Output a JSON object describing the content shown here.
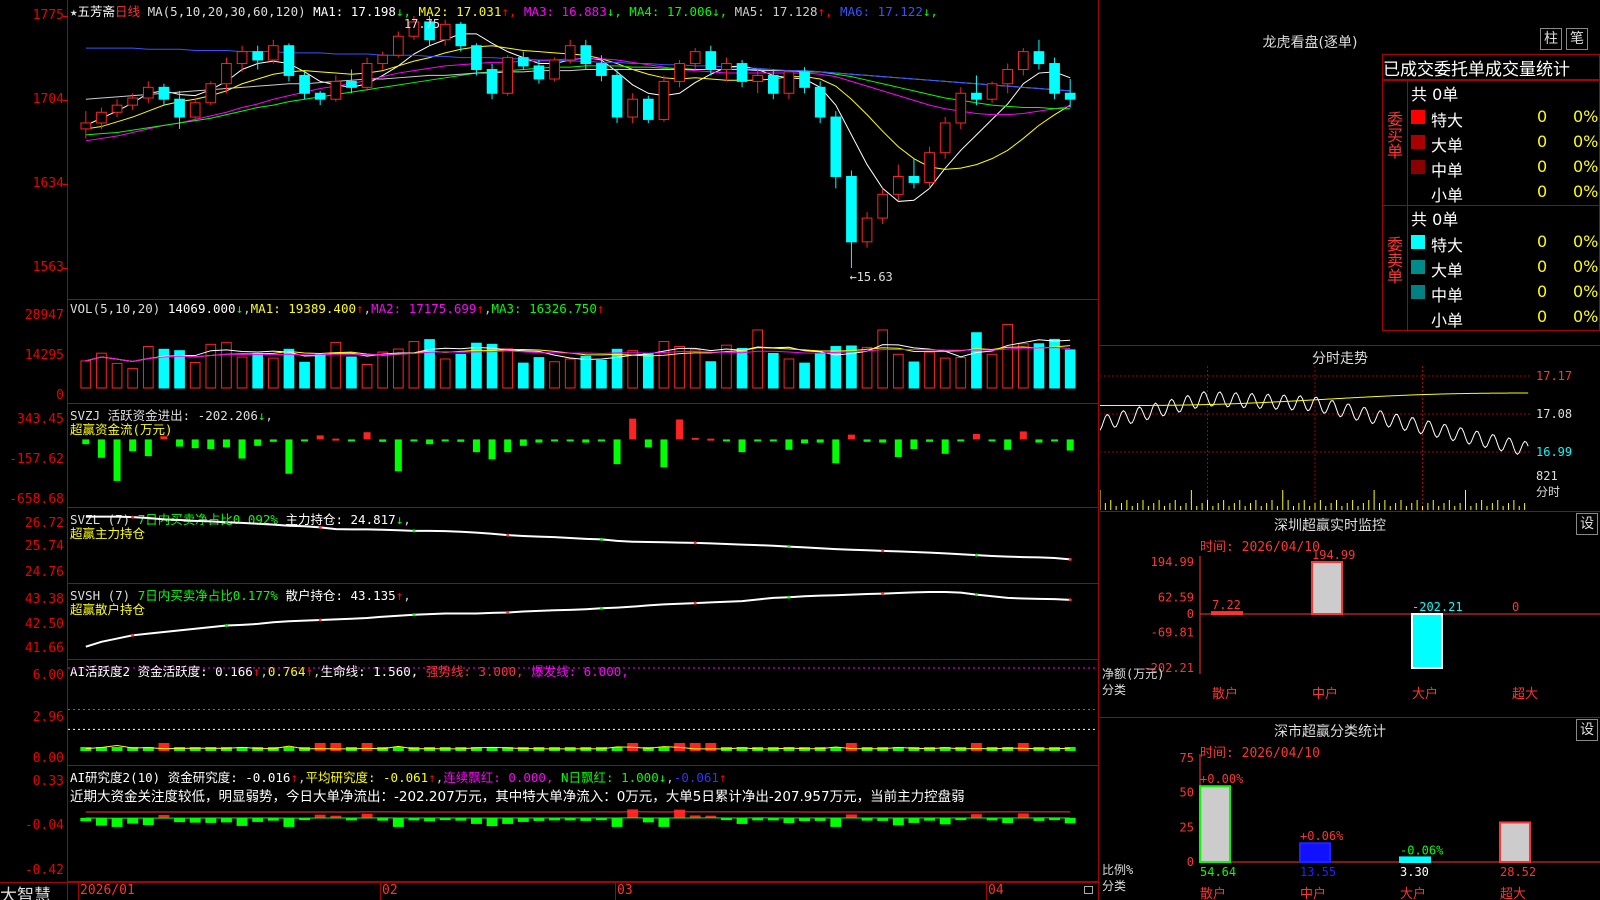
{
  "header": {
    "star": "★",
    "stock": "五芳斋",
    "period": "日线",
    "ma_params": "MA(5,10,20,30,60,120)",
    "ma": [
      {
        "l": "MA1:",
        "v": "17.198",
        "d": "↓",
        "c": "#ffffff"
      },
      {
        "l": "MA2:",
        "v": "17.031",
        "d": "↑",
        "c": "#ffff00"
      },
      {
        "l": "MA3:",
        "v": "16.883",
        "d": "↓",
        "c": "#ff00ff"
      },
      {
        "l": "MA4:",
        "v": "17.006",
        "d": "↓",
        "c": "#00ff00"
      },
      {
        "l": "MA5:",
        "v": "17.128",
        "d": "↑",
        "c": "#cccccc"
      },
      {
        "l": "MA6:",
        "v": "17.122",
        "d": "↓",
        "c": "#3355ff"
      }
    ]
  },
  "price_axis": [
    "1775",
    "1704",
    "1634",
    "1563"
  ],
  "annot_high": "17.75",
  "annot_low": "←15.63",
  "vol": {
    "title": "VOL(5,10,20)",
    "val": "14069.000",
    "arr": "↓",
    "ma1": "MA1: 19389.400",
    "ma2": "MA2: 17175.699",
    "ma3": "MA3: 16326.750",
    "axis": [
      "28947",
      "14295",
      "0"
    ]
  },
  "svzj": {
    "title": "SVZJ  活跃资金进出: -202.206",
    "sub": "超赢资金流(万元)",
    "axis": [
      "343.45",
      "-157.62",
      "-658.68"
    ]
  },
  "svzl": {
    "title": "SVZL (7)",
    "g": "7日内买卖净占比0.092%",
    "w": "主力持仓: 24.817",
    "sub": "超赢主力持仓",
    "axis": [
      "26.72",
      "25.74",
      "24.76"
    ]
  },
  "svsh": {
    "title": "SVSH (7)",
    "g": "7日内买卖净占比0.177%",
    "w": "散户持仓: 43.135",
    "sub": "超赢散户持仓",
    "axis": [
      "43.38",
      "42.50",
      "41.66"
    ]
  },
  "ai2": {
    "a": "AI活跃度2 资金活跃度: 0.166",
    "b": "0.764",
    "c": "生命线: 1.560,",
    "d": "强势线: 3.000,",
    "e": "爆发线: 6.000,",
    "axis": [
      "6.00",
      "2.96",
      "0.00"
    ]
  },
  "ai3": {
    "a": "AI研究度2(10) 资金研究度: -0.016",
    "b": "平均研究度: -0.061",
    "c": "连续飘红: 0.000,",
    "d": "N日飘红: 1.000",
    "e": "-0.061",
    "axis": [
      "0.33",
      "-0.04",
      "-0.42"
    ],
    "text": "近期大资金关注度较低，明显弱势，今日大单净流出：-202.207万元，其中特大单净流入：0万元，大单5日累计净出-207.957万元，当前主力控盘弱"
  },
  "dates": [
    "2026/01",
    "02",
    "03",
    "04"
  ],
  "logo": "大智慧",
  "right": {
    "lhb_title": "龙虎看盘(逐单)",
    "tab_zhu": "柱",
    "tab_bi": "笔",
    "tabs": [
      "已成交",
      "委托单",
      "成交量统计"
    ],
    "buy": {
      "side": "委买单",
      "total": "共 0单",
      "rows": [
        {
          "n": "特大",
          "v": "0",
          "p": "0%",
          "c": "#ff0000"
        },
        {
          "n": "大单",
          "v": "0",
          "p": "0%",
          "c": "#aa0000"
        },
        {
          "n": "中单",
          "v": "0",
          "p": "0%",
          "c": "#880000"
        },
        {
          "n": "小单",
          "v": "0",
          "p": "0%",
          "c": "#000000"
        }
      ]
    },
    "sell": {
      "side": "委卖单",
      "total": "共 0单",
      "rows": [
        {
          "n": "特大",
          "v": "0",
          "p": "0%",
          "c": "#00ffff"
        },
        {
          "n": "大单",
          "v": "0",
          "p": "0%",
          "c": "#008b8b"
        },
        {
          "n": "中单",
          "v": "0",
          "p": "0%",
          "c": "#008080"
        },
        {
          "n": "小单",
          "v": "0",
          "p": "0%",
          "c": "#000000"
        }
      ]
    },
    "fs_title": "分时走势",
    "fs_axis": [
      "17.17",
      "17.08",
      "16.99"
    ],
    "fs_vol": "821",
    "fs_unit": "分时",
    "sz_title": "深圳超赢实时监控",
    "sz_set": "设",
    "sz_time": "时间: 2026/04/10",
    "sz_axis": [
      "194.99",
      "62.59",
      "0",
      "-69.81",
      "-202.21"
    ],
    "sz_ylabel": "净额(万元)",
    "sz_xlabel": "分类",
    "sz_vals": [
      {
        "cat": "散户",
        "v": "7.22"
      },
      {
        "cat": "中户",
        "v": "194.99"
      },
      {
        "cat": "大户",
        "v": "-202.21"
      },
      {
        "cat": "超大",
        "v": "0"
      }
    ],
    "cls_title": "深市超赢分类统计",
    "cls_set": "设",
    "cls_time": "时间: 2026/04/10",
    "cls_axis": [
      "75",
      "50",
      "25",
      "0"
    ],
    "cls_ylabel": "比例%",
    "cls_xlabel": "分类",
    "cls_vals": [
      {
        "cat": "散户",
        "v": "54.64",
        "chg": "+0.00%"
      },
      {
        "cat": "中户",
        "v": "13.55",
        "chg": "+0.06%"
      },
      {
        "cat": "大户",
        "v": "3.30",
        "chg": "-0.06%"
      },
      {
        "cat": "超大",
        "v": "28.52",
        "chg": ""
      }
    ]
  },
  "chart_data": {
    "type": "candlestick",
    "title": "五芳斋 日线",
    "ohlc": [
      [
        16.8,
        16.95,
        16.72,
        16.85
      ],
      [
        16.85,
        16.98,
        16.8,
        16.94
      ],
      [
        16.94,
        17.05,
        16.9,
        17.0
      ],
      [
        17.0,
        17.1,
        16.96,
        17.06
      ],
      [
        17.06,
        17.2,
        17.02,
        17.15
      ],
      [
        17.15,
        17.18,
        17.0,
        17.05
      ],
      [
        17.05,
        17.12,
        16.8,
        16.9
      ],
      [
        16.9,
        17.06,
        16.88,
        17.02
      ],
      [
        17.02,
        17.2,
        17.0,
        17.18
      ],
      [
        17.18,
        17.4,
        17.1,
        17.35
      ],
      [
        17.35,
        17.5,
        17.28,
        17.45
      ],
      [
        17.45,
        17.5,
        17.3,
        17.38
      ],
      [
        17.38,
        17.55,
        17.35,
        17.5
      ],
      [
        17.5,
        17.52,
        17.2,
        17.25
      ],
      [
        17.25,
        17.28,
        17.05,
        17.1
      ],
      [
        17.1,
        17.12,
        17.0,
        17.05
      ],
      [
        17.05,
        17.25,
        17.03,
        17.2
      ],
      [
        17.2,
        17.3,
        17.1,
        17.15
      ],
      [
        17.15,
        17.4,
        17.12,
        17.35
      ],
      [
        17.35,
        17.45,
        17.3,
        17.42
      ],
      [
        17.42,
        17.62,
        17.4,
        17.58
      ],
      [
        17.58,
        17.75,
        17.55,
        17.7
      ],
      [
        17.7,
        17.75,
        17.5,
        17.55
      ],
      [
        17.55,
        17.72,
        17.5,
        17.68
      ],
      [
        17.68,
        17.7,
        17.45,
        17.5
      ],
      [
        17.5,
        17.52,
        17.25,
        17.3
      ],
      [
        17.3,
        17.35,
        17.05,
        17.1
      ],
      [
        17.1,
        17.42,
        17.08,
        17.4
      ],
      [
        17.4,
        17.45,
        17.3,
        17.33
      ],
      [
        17.33,
        17.38,
        17.18,
        17.22
      ],
      [
        17.22,
        17.4,
        17.2,
        17.38
      ],
      [
        17.38,
        17.55,
        17.35,
        17.5
      ],
      [
        17.5,
        17.55,
        17.3,
        17.35
      ],
      [
        17.35,
        17.42,
        17.2,
        17.25
      ],
      [
        17.25,
        17.3,
        16.85,
        16.9
      ],
      [
        16.9,
        17.1,
        16.85,
        17.05
      ],
      [
        17.05,
        17.08,
        16.85,
        16.88
      ],
      [
        16.88,
        17.25,
        16.86,
        17.2
      ],
      [
        17.2,
        17.38,
        17.15,
        17.35
      ],
      [
        17.35,
        17.48,
        17.3,
        17.45
      ],
      [
        17.45,
        17.5,
        17.25,
        17.3
      ],
      [
        17.3,
        17.4,
        17.2,
        17.35
      ],
      [
        17.35,
        17.38,
        17.15,
        17.2
      ],
      [
        17.2,
        17.3,
        17.1,
        17.25
      ],
      [
        17.25,
        17.3,
        17.05,
        17.1
      ],
      [
        17.1,
        17.3,
        17.05,
        17.28
      ],
      [
        17.28,
        17.32,
        17.1,
        17.15
      ],
      [
        17.15,
        17.2,
        16.85,
        16.9
      ],
      [
        16.9,
        16.95,
        16.3,
        16.4
      ],
      [
        16.4,
        16.45,
        15.63,
        15.85
      ],
      [
        15.85,
        16.1,
        15.8,
        16.05
      ],
      [
        16.05,
        16.3,
        16.0,
        16.25
      ],
      [
        16.25,
        16.5,
        16.2,
        16.4
      ],
      [
        16.4,
        16.55,
        16.3,
        16.35
      ],
      [
        16.35,
        16.65,
        16.3,
        16.6
      ],
      [
        16.6,
        16.9,
        16.55,
        16.85
      ],
      [
        16.85,
        17.15,
        16.8,
        17.1
      ],
      [
        17.1,
        17.25,
        17.0,
        17.05
      ],
      [
        17.05,
        17.2,
        17.02,
        17.18
      ],
      [
        17.18,
        17.35,
        17.1,
        17.3
      ],
      [
        17.3,
        17.48,
        17.25,
        17.45
      ],
      [
        17.45,
        17.55,
        17.3,
        17.35
      ],
      [
        17.35,
        17.4,
        17.05,
        17.1
      ],
      [
        17.1,
        17.22,
        16.98,
        17.05
      ]
    ],
    "volume": [
      9800,
      12600,
      8900,
      7000,
      15000,
      14000,
      13500,
      9200,
      15800,
      16400,
      11200,
      12500,
      10800,
      14000,
      9300,
      12100,
      16500,
      11200,
      8500,
      13000,
      14100,
      16800,
      17500,
      10500,
      12200,
      16200,
      15800,
      14200,
      9000,
      11000,
      9500,
      10500,
      11500,
      10000,
      14000,
      13500,
      12500,
      16800,
      15000,
      13800,
      9500,
      15500,
      14300,
      21000,
      12500,
      10500,
      9000,
      12600,
      15000,
      15200,
      14700,
      21000,
      12200,
      9400,
      13000,
      10800,
      11000,
      20000,
      12200,
      23000,
      16000,
      16000,
      17600,
      13800
    ],
    "ma5": [
      16.83,
      16.89,
      16.95,
      17.02,
      17.1,
      17.12,
      17.09,
      17.08,
      17.13,
      17.2,
      17.3,
      17.35,
      17.37,
      17.35,
      17.28,
      17.2,
      17.17,
      17.15,
      17.18,
      17.25,
      17.33,
      17.43,
      17.5,
      17.55,
      17.6,
      17.6,
      17.52,
      17.45,
      17.4,
      17.35,
      17.35,
      17.38,
      17.4,
      17.38,
      17.28,
      17.17,
      17.1,
      17.08,
      17.1,
      17.19,
      17.26,
      17.32,
      17.33,
      17.3,
      17.25,
      17.23,
      17.22,
      17.15,
      17.0,
      16.75,
      16.5,
      16.3,
      16.19,
      16.2,
      16.3,
      16.47,
      16.62,
      16.75,
      16.88,
      17.01,
      17.18,
      17.27,
      17.28,
      17.23
    ],
    "ma10": [
      16.8,
      16.82,
      16.86,
      16.9,
      16.95,
      17.0,
      17.03,
      17.05,
      17.08,
      17.12,
      17.18,
      17.22,
      17.26,
      17.28,
      17.29,
      17.28,
      17.27,
      17.26,
      17.27,
      17.29,
      17.33,
      17.37,
      17.4,
      17.44,
      17.47,
      17.49,
      17.5,
      17.48,
      17.46,
      17.45,
      17.44,
      17.43,
      17.42,
      17.39,
      17.35,
      17.3,
      17.26,
      17.23,
      17.22,
      17.23,
      17.22,
      17.21,
      17.21,
      17.21,
      17.22,
      17.24,
      17.24,
      17.22,
      17.16,
      17.05,
      16.92,
      16.78,
      16.65,
      16.55,
      16.48,
      16.46,
      16.47,
      16.5,
      16.55,
      16.62,
      16.72,
      16.83,
      16.92,
      17.0
    ],
    "ma20": [
      16.7,
      16.72,
      16.74,
      16.77,
      16.8,
      16.83,
      16.85,
      16.88,
      16.91,
      16.94,
      16.98,
      17.01,
      17.05,
      17.08,
      17.11,
      17.14,
      17.16,
      17.18,
      17.21,
      17.24,
      17.27,
      17.29,
      17.31,
      17.33,
      17.34,
      17.35,
      17.36,
      17.36,
      17.37,
      17.37,
      17.38,
      17.39,
      17.39,
      17.39,
      17.38,
      17.36,
      17.34,
      17.32,
      17.3,
      17.29,
      17.28,
      17.27,
      17.27,
      17.27,
      17.27,
      17.27,
      17.27,
      17.26,
      17.24,
      17.2,
      17.16,
      17.12,
      17.08,
      17.04,
      17.0,
      16.97,
      16.95,
      16.93,
      16.92,
      16.92,
      16.93,
      16.95,
      16.97,
      16.99
    ],
    "ma30": [
      16.75,
      16.76,
      16.77,
      16.79,
      16.81,
      16.83,
      16.85,
      16.87,
      16.89,
      16.92,
      16.95,
      16.98,
      17.0,
      17.03,
      17.05,
      17.07,
      17.09,
      17.11,
      17.13,
      17.15,
      17.17,
      17.19,
      17.21,
      17.23,
      17.25,
      17.27,
      17.28,
      17.29,
      17.3,
      17.31,
      17.32,
      17.32,
      17.33,
      17.33,
      17.33,
      17.32,
      17.32,
      17.31,
      17.31,
      17.3,
      17.3,
      17.3,
      17.3,
      17.3,
      17.29,
      17.29,
      17.29,
      17.28,
      17.26,
      17.24,
      17.21,
      17.18,
      17.15,
      17.12,
      17.09,
      17.06,
      17.04,
      17.02,
      17.0,
      16.99,
      16.98,
      16.98,
      16.97,
      16.97
    ],
    "ma60": [
      17.05,
      17.06,
      17.07,
      17.08,
      17.09,
      17.1,
      17.11,
      17.12,
      17.13,
      17.14,
      17.15,
      17.16,
      17.17,
      17.18,
      17.18,
      17.19,
      17.2,
      17.21,
      17.22,
      17.22,
      17.23,
      17.24,
      17.25,
      17.25,
      17.26,
      17.27,
      17.27,
      17.28,
      17.28,
      17.29,
      17.29,
      17.29,
      17.3,
      17.3,
      17.3,
      17.3,
      17.3,
      17.3,
      17.3,
      17.3,
      17.3,
      17.3,
      17.3,
      17.29,
      17.29,
      17.29,
      17.28,
      17.28,
      17.27,
      17.26,
      17.25,
      17.24,
      17.23,
      17.22,
      17.21,
      17.2,
      17.19,
      17.18,
      17.17,
      17.16,
      17.15,
      17.14,
      17.13,
      17.12
    ],
    "ma120": [
      17.48,
      17.48,
      17.48,
      17.48,
      17.47,
      17.47,
      17.47,
      17.46,
      17.46,
      17.46,
      17.45,
      17.45,
      17.45,
      17.44,
      17.44,
      17.44,
      17.43,
      17.43,
      17.43,
      17.42,
      17.42,
      17.42,
      17.41,
      17.41,
      17.4,
      17.4,
      17.4,
      17.39,
      17.39,
      17.38,
      17.38,
      17.37,
      17.37,
      17.36,
      17.36,
      17.35,
      17.35,
      17.34,
      17.34,
      17.33,
      17.33,
      17.32,
      17.31,
      17.31,
      17.3,
      17.29,
      17.29,
      17.28,
      17.27,
      17.26,
      17.25,
      17.24,
      17.23,
      17.22,
      17.21,
      17.2,
      17.19,
      17.18,
      17.17,
      17.16,
      17.15,
      17.14,
      17.13,
      17.12
    ],
    "svzj": [
      -60,
      -230,
      -520,
      -150,
      -210,
      40,
      -90,
      -110,
      -120,
      -100,
      -240,
      -80,
      -30,
      -430,
      -10,
      50,
      10,
      -20,
      90,
      -30,
      -400,
      -20,
      -60,
      -10,
      -30,
      -160,
      -250,
      -160,
      -80,
      -40,
      -20,
      -20,
      -40,
      -15,
      -310,
      260,
      -100,
      -350,
      250,
      20,
      10,
      -10,
      -160,
      -20,
      -20,
      -130,
      -50,
      -40,
      -300,
      60,
      -30,
      -40,
      -220,
      -120,
      -30,
      -180,
      -10,
      70,
      -20,
      -130,
      100,
      -40,
      -10,
      -140
    ],
    "svzl": [
      26.7,
      26.7,
      26.7,
      26.68,
      26.65,
      26.6,
      26.58,
      26.55,
      26.53,
      26.5,
      26.48,
      26.45,
      26.42,
      26.38,
      26.36,
      26.32,
      26.26,
      26.25,
      26.25,
      26.24,
      26.22,
      26.2,
      26.2,
      26.19,
      26.17,
      26.14,
      26.1,
      26.05,
      26.02,
      26.0,
      25.98,
      25.95,
      25.92,
      25.9,
      25.85,
      25.82,
      25.81,
      25.8,
      25.79,
      25.78,
      25.76,
      25.74,
      25.72,
      25.7,
      25.68,
      25.65,
      25.62,
      25.59,
      25.56,
      25.54,
      25.52,
      25.5,
      25.48,
      25.46,
      25.44,
      25.41,
      25.38,
      25.35,
      25.32,
      25.3,
      25.28,
      25.27,
      25.25,
      25.2
    ],
    "svsh": [
      41.7,
      41.85,
      41.95,
      42.05,
      42.1,
      42.15,
      42.2,
      42.25,
      42.3,
      42.35,
      42.37,
      42.4,
      42.45,
      42.48,
      42.5,
      42.52,
      42.54,
      42.56,
      42.58,
      42.62,
      42.65,
      42.68,
      42.7,
      42.72,
      42.72,
      42.72,
      42.74,
      42.75,
      42.78,
      42.8,
      42.82,
      42.83,
      42.85,
      42.88,
      42.9,
      42.93,
      42.97,
      43.0,
      43.02,
      43.04,
      43.06,
      43.08,
      43.1,
      43.15,
      43.2,
      43.22,
      43.25,
      43.27,
      43.28,
      43.3,
      43.32,
      43.33,
      43.35,
      43.37,
      43.38,
      43.38,
      43.36,
      43.3,
      43.25,
      43.2,
      43.18,
      43.17,
      43.16,
      43.14
    ]
  }
}
